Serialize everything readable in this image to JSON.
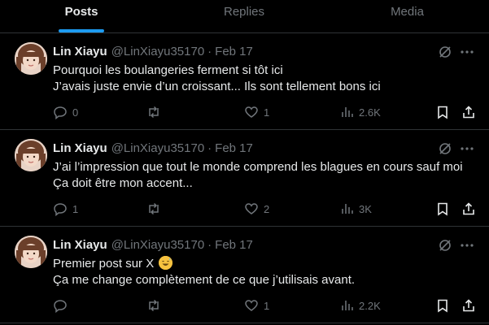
{
  "tabs": [
    {
      "label": "Posts",
      "active": true
    },
    {
      "label": "Replies",
      "active": false
    },
    {
      "label": "Media",
      "active": false
    }
  ],
  "colors": {
    "accent": "#1d9bf0",
    "muted": "#71767b",
    "text": "#e7e9ea",
    "border": "#2f3336",
    "background": "#000000"
  },
  "tweets": [
    {
      "name": "Lin Xiayu",
      "handle": "@LinXiayu35170",
      "date": "Feb 17",
      "line1": "Pourquoi les boulangeries ferment si tôt ici",
      "line2": "J’avais juste envie d’un croissant... Ils sont tellement bons ici",
      "replies": "0",
      "retweets": "",
      "likes": "1",
      "views": "2.6K"
    },
    {
      "name": "Lin Xiayu",
      "handle": "@LinXiayu35170",
      "date": "Feb 17",
      "line1": "J’ai l’impression que tout le monde comprend les blagues en cours sauf moi",
      "line2": "Ça doit être mon accent...",
      "replies": "1",
      "retweets": "",
      "likes": "2",
      "views": "3K"
    },
    {
      "name": "Lin Xiayu",
      "handle": "@LinXiayu35170",
      "date": "Feb 17",
      "line1": "Premier post sur X",
      "emoji": "grinning-sweat-emoji",
      "line2": "Ça me change complètement de ce que j’utilisais avant.",
      "replies": "",
      "retweets": "",
      "likes": "1",
      "views": "2.2K"
    }
  ],
  "icons": {
    "reply": "reply-icon",
    "retweet": "retweet-icon",
    "like": "heart-icon",
    "views": "views-icon",
    "bookmark": "bookmark-icon",
    "share": "share-icon",
    "grok": "grok-icon",
    "more": "more-icon"
  }
}
